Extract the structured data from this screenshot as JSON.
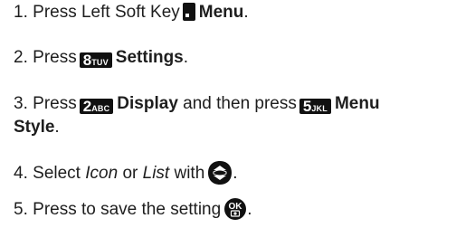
{
  "steps": [
    {
      "number": "1.",
      "text": "Press Left Soft Key",
      "icon": "left-softkey-icon",
      "bold": "Menu",
      "end": "."
    },
    {
      "number": "2.",
      "text": "Press",
      "key": {
        "num": "8",
        "letters": "TUV"
      },
      "bold": "Settings",
      "end": "."
    },
    {
      "number": "3.",
      "text": "Press",
      "key": {
        "num": "2",
        "letters": "ABC"
      },
      "bold": "Display",
      "middle": "and then press",
      "key2": {
        "num": "5",
        "letters": "JKL"
      },
      "bold2a": "Menu",
      "bold2b": "Style",
      "end": "."
    },
    {
      "number": "4.",
      "text": "Select",
      "italic1": "Icon",
      "or": "or",
      "italic2": "List",
      "with": "with",
      "icon": "navigation-key-icon",
      "end": "."
    },
    {
      "number": "5.",
      "text": "Press to save the setting",
      "icon": "ok-key-icon",
      "ok_label": "OK",
      "end": "."
    }
  ],
  "colors": {
    "text": "#1e1e1e",
    "key_bg": "#111111",
    "key_fg": "#ffffff"
  }
}
